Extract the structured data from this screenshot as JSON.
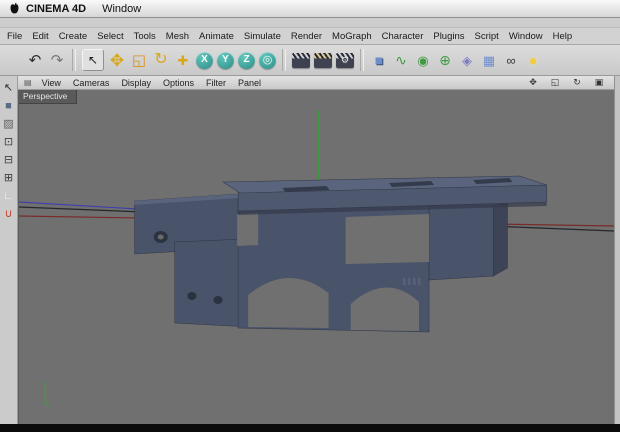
{
  "macos_menubar": {
    "app_name": "CINEMA 4D",
    "menus": [
      "Window"
    ]
  },
  "app_menubar": {
    "menus": [
      "File",
      "Edit",
      "Create",
      "Select",
      "Tools",
      "Mesh",
      "Animate",
      "Simulate",
      "Render",
      "MoGraph",
      "Character",
      "Plugins",
      "Script",
      "Window",
      "Help"
    ]
  },
  "toolbar": {
    "icons": [
      {
        "name": "undo-icon",
        "glyph": "↶",
        "color": "#2e2e2e"
      },
      {
        "name": "redo-icon",
        "glyph": "↷",
        "color": "#777777"
      },
      {
        "name": "divider"
      },
      {
        "name": "live-selection-tool-icon",
        "glyph": "↖",
        "color": "#1a1a1a",
        "cls": "raised"
      },
      {
        "name": "move-tool-icon",
        "glyph": "✥",
        "color": "#d8a818",
        "fs": 17
      },
      {
        "name": "scale-tool-icon",
        "glyph": "◱",
        "color": "#d89018",
        "fs": 15
      },
      {
        "name": "rotate-tool-icon",
        "glyph": "↻",
        "color": "#d8a818",
        "fs": 16
      },
      {
        "name": "last-tool-icon",
        "glyph": "✚",
        "color": "#d8a818",
        "fs": 13
      },
      {
        "name": "x-axis-lock-icon",
        "glyph": "X",
        "cls": "round",
        "color": "#ffffff",
        "bgcss": "radial-gradient(circle at 35% 30%, #63c6bd, #2a8e86)"
      },
      {
        "name": "y-axis-lock-icon",
        "glyph": "Y",
        "cls": "round",
        "color": "#ffffff",
        "bgcss": "radial-gradient(circle at 35% 30%, #63c6bd, #2a8e86)"
      },
      {
        "name": "z-axis-lock-icon",
        "glyph": "Z",
        "cls": "round",
        "color": "#ffffff",
        "bgcss": "radial-gradient(circle at 35% 30%, #63c6bd, #2a8e86)"
      },
      {
        "name": "coordinate-system-icon",
        "glyph": "◎",
        "cls": "round",
        "color": "#eaf6f4",
        "fs": 11,
        "bgcss": "radial-gradient(circle at 35% 30%, #63c6bd, #2a8e86)"
      },
      {
        "name": "divider"
      },
      {
        "name": "render-view-icon",
        "cls": "clap",
        "bgcss": "linear-gradient(180deg, rgba(0,0,0,0) 0 36%, #3e4250 36% 100%), repeating-linear-gradient(55deg, #2b2b33 0 2px, #cfd2da 2px 4px)"
      },
      {
        "name": "render-picture-viewer-icon",
        "cls": "clap",
        "bgcss": "linear-gradient(180deg, rgba(0,0,0,0) 0 36%, #3e4250 36% 100%), repeating-linear-gradient(55deg, #2b2b33 0 2px, #d8c8a0 2px 4px)"
      },
      {
        "name": "render-settings-icon",
        "cls": "clap",
        "glyph": "⚙",
        "color": "#e8e8e8",
        "fs": 9,
        "bgcss": "linear-gradient(180deg, rgba(0,0,0,0) 0 36%, #3e4250 36% 100%), repeating-linear-gradient(55deg, #2b2b33 0 2px, #cfd2da 2px 4px)"
      },
      {
        "name": "divider"
      },
      {
        "name": "add-primitive-cube-icon",
        "glyph": "■",
        "color": "#6f8ccc",
        "fs": 14,
        "cls": "cube3d"
      },
      {
        "name": "spline-pen-icon",
        "glyph": "∿",
        "color": "#3f9b3f",
        "fs": 14
      },
      {
        "name": "subdivision-surface-icon",
        "glyph": "◉",
        "color": "#3f9b3f",
        "fs": 13
      },
      {
        "name": "modeling-generator-icon",
        "glyph": "⊕",
        "color": "#3f9b3f",
        "fs": 14
      },
      {
        "name": "deformer-icon",
        "glyph": "◈",
        "color": "#7d7dc0",
        "fs": 13
      },
      {
        "name": "floor-object-icon",
        "glyph": "▦",
        "color": "#6f8ccc",
        "fs": 13
      },
      {
        "name": "sky-object-icon",
        "glyph": "∞",
        "color": "#3a3a3a",
        "fs": 13
      },
      {
        "name": "light-object-icon",
        "glyph": "●",
        "color": "#f2cc3a",
        "cls": "glow",
        "fs": 13
      }
    ]
  },
  "left_toolbar": {
    "icons": [
      {
        "name": "pointer-tool-icon",
        "glyph": "↖",
        "color": "#2a2a2a"
      },
      {
        "name": "model-mode-icon",
        "glyph": "■",
        "color": "#5a6b85"
      },
      {
        "name": "texture-mode-icon",
        "glyph": "▨",
        "color": "#5e5e5e"
      },
      {
        "name": "points-mode-icon",
        "glyph": "⊡",
        "color": "#3d3d3d"
      },
      {
        "name": "edges-mode-icon",
        "glyph": "⊟",
        "color": "#3d3d3d"
      },
      {
        "name": "polygons-mode-icon",
        "glyph": "⊞",
        "color": "#3d3d3d"
      },
      {
        "name": "workplane-icon",
        "glyph": "∟",
        "color": "#f2f2f2"
      },
      {
        "name": "snap-magnet-icon",
        "glyph": "∪",
        "color": "#c04030"
      }
    ]
  },
  "viewport_menubar": {
    "menus": [
      "View",
      "Cameras",
      "Display",
      "Options",
      "Filter",
      "Panel"
    ],
    "right_icons": [
      {
        "name": "camera-pan-icon",
        "glyph": "✥",
        "color": "#333333"
      },
      {
        "name": "camera-zoom-icon",
        "glyph": "◱",
        "color": "#333333"
      },
      {
        "name": "camera-rotate-icon",
        "glyph": "↻",
        "color": "#333333"
      },
      {
        "name": "viewport-toggle-icon",
        "glyph": "▣",
        "color": "#333333"
      }
    ]
  },
  "viewport": {
    "camera_label": "Perspective"
  },
  "colors": {
    "viewport_bg": "#707070",
    "model_top": "#5a657d",
    "model_front": "#49536a",
    "plate_front": "#4e586e",
    "model_dark": "#343b4c",
    "model_cap": "#3d4456",
    "hole_dark": "#2c3340",
    "hole_inner": "#6a6a6a",
    "axis_green": "#3f9b3f",
    "axis_red": "#7a2a2a",
    "axis_blue": "#4040a8",
    "horizon_dark": "#26262c"
  }
}
